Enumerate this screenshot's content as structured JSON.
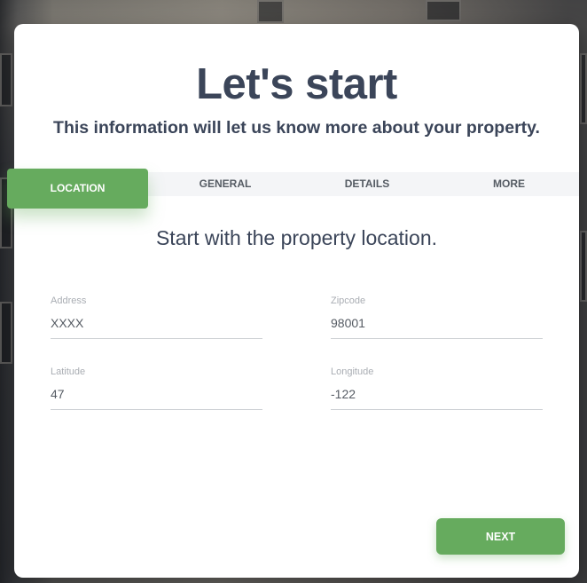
{
  "header": {
    "title": "Let's start",
    "subtitle": "This information will let us know more about your property."
  },
  "tabs": [
    {
      "label": "LOCATION",
      "active": true
    },
    {
      "label": "GENERAL",
      "active": false
    },
    {
      "label": "DETAILS",
      "active": false
    },
    {
      "label": "MORE",
      "active": false
    }
  ],
  "section": {
    "heading": "Start with the property location."
  },
  "fields": {
    "address": {
      "label": "Address",
      "value": "XXXX"
    },
    "zipcode": {
      "label": "Zipcode",
      "value": "98001"
    },
    "latitude": {
      "label": "Latitude",
      "value": "47"
    },
    "longitude": {
      "label": "Longitude",
      "value": "-122"
    }
  },
  "actions": {
    "next_label": "NEXT"
  },
  "colors": {
    "accent": "#66ab5e",
    "heading": "#3b4559",
    "tab_bar": "#f4f5f7"
  }
}
